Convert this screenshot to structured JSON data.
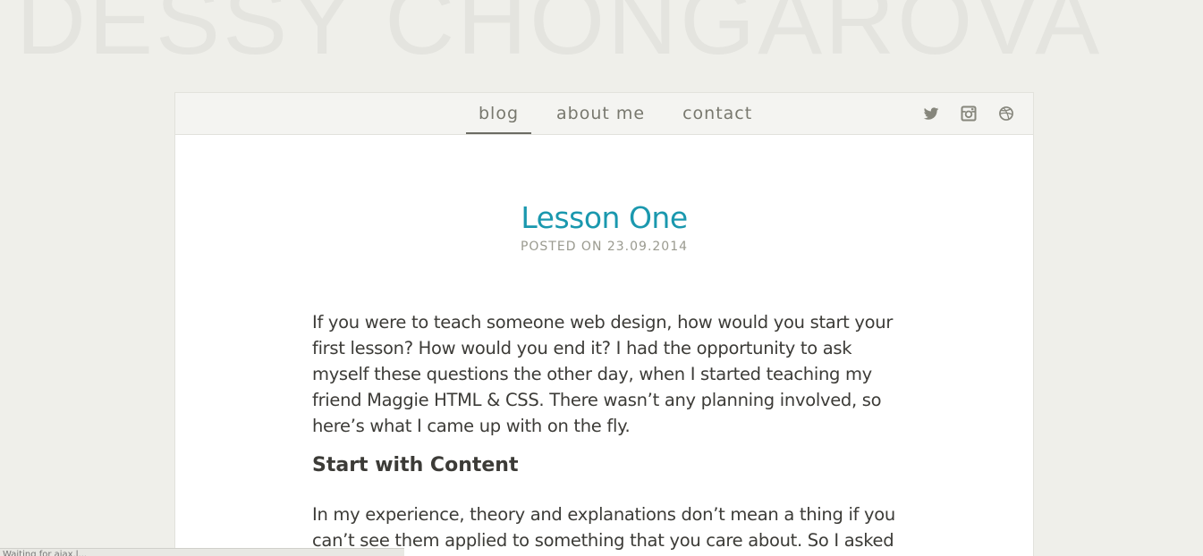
{
  "site": {
    "title": "DESSY CHONGAROVA"
  },
  "nav": {
    "items": [
      {
        "label": "blog",
        "active": true
      },
      {
        "label": "about me",
        "active": false
      },
      {
        "label": "contact",
        "active": false
      }
    ],
    "social": [
      "twitter-icon",
      "instagram-icon",
      "dribbble-icon"
    ]
  },
  "post": {
    "title": "Lesson One",
    "date": "POSTED ON 23.09.2014",
    "paragraph1": "If you were to teach someone web design, how would you start your first lesson? How would you end it? I had the opportunity to ask myself these questions the other day, when I started teaching my friend Maggie HTML & CSS. There wasn’t any planning involved, so here’s what I came up with on the fly.",
    "heading1": "Start with Content",
    "paragraph2": "In my experience, theory and explanations don’t mean a thing if you can’t see them applied to something that you care about. So I asked"
  },
  "status": {
    "text": "Waiting for ajax.l..."
  },
  "colors": {
    "accent": "#1a98ae",
    "background": "#efefea",
    "text": "#3c3b37"
  }
}
